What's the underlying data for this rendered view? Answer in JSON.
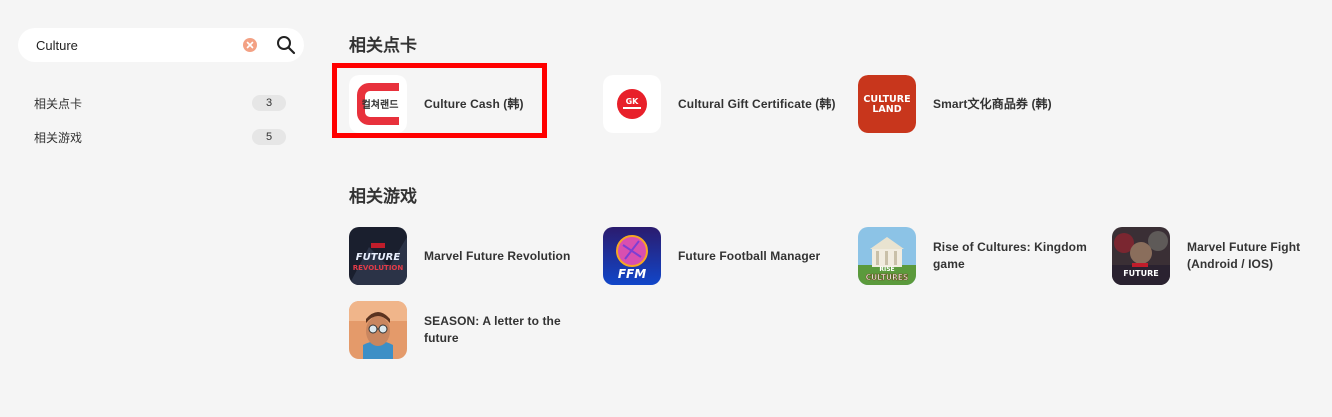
{
  "search": {
    "value": "Culture",
    "placeholder": ""
  },
  "sidebar": {
    "items": [
      {
        "label": "相关点卡",
        "count": "3"
      },
      {
        "label": "相关游戏",
        "count": "5"
      }
    ]
  },
  "sections": {
    "cards": {
      "title": "相关点卡",
      "items": [
        {
          "name": "Culture Cash (韩)",
          "icon": "culture-cash-logo",
          "logo_text": "컬쳐랜드",
          "highlighted": true
        },
        {
          "name": "Cultural Gift Certificate (韩)",
          "icon": "cultural-gift-logo",
          "logo_text": "GK"
        },
        {
          "name": "Smart文化商品券 (韩)",
          "icon": "culture-land-logo",
          "logo_text": [
            "CULTURE",
            "LAND"
          ]
        }
      ]
    },
    "games": {
      "title": "相关游戏",
      "items": [
        {
          "name": "Marvel Future Revolution",
          "icon": "marvel-future-revolution-art",
          "logo_text": [
            "FUTURE",
            "REVOLUTION"
          ]
        },
        {
          "name": "Future Football Manager",
          "icon": "future-football-manager-art",
          "logo_text": "FFM"
        },
        {
          "name": "Rise of Cultures: Kingdom game",
          "icon": "rise-of-cultures-art",
          "logo_text": [
            "RISE",
            "CULTURES"
          ]
        },
        {
          "name": "Marvel Future Fight (Android / IOS)",
          "icon": "marvel-future-fight-art",
          "logo_text": "FUTURE"
        },
        {
          "name": "SEASON: A letter to the future",
          "icon": "season-art"
        }
      ]
    }
  },
  "colors": {
    "page_bg": "#f5f5f5",
    "highlight": "#ff0000",
    "clear_button": "#f3a184",
    "culture_land_red": "#c8361c"
  }
}
